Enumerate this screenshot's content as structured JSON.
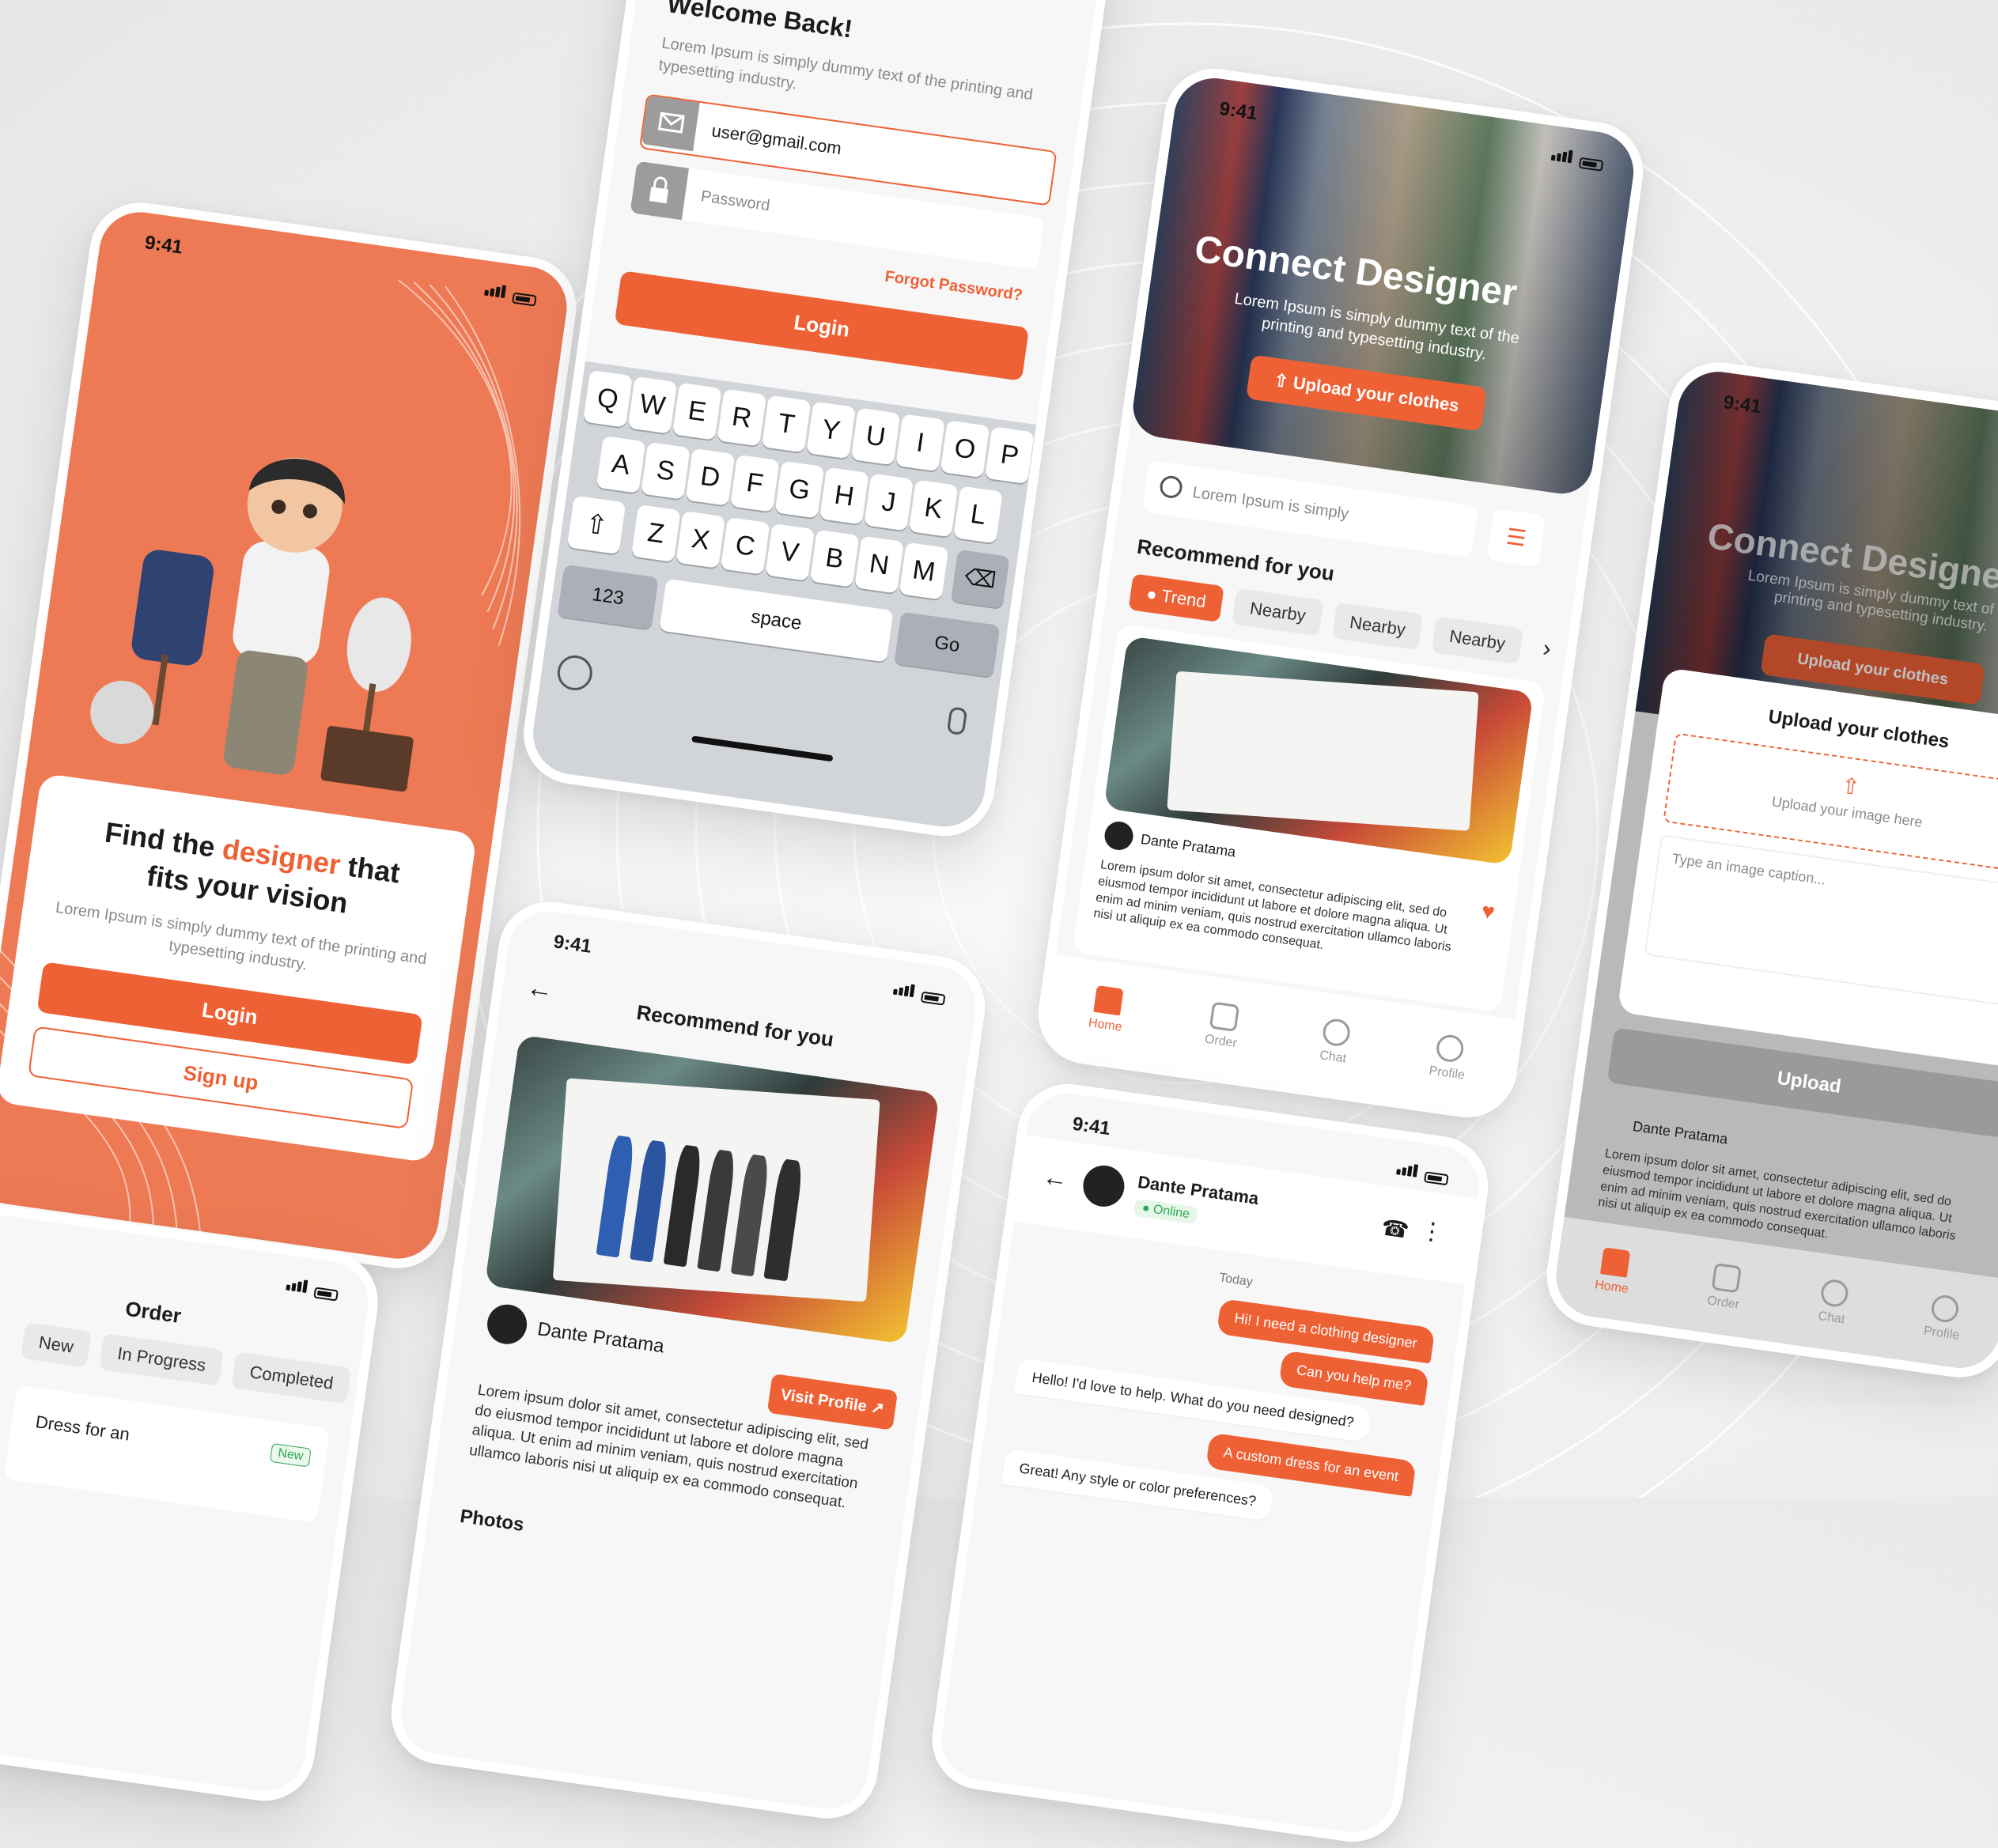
{
  "status_time": "9:41",
  "accent": "#ee6135",
  "onboarding": {
    "title_pre": "Find the",
    "title_accent": "designer",
    "title_post": "that",
    "title_line2": "fits your vision",
    "desc": "Lorem Ipsum is simply dummy text of the printing and typesetting industry.",
    "login": "Login",
    "signup": "Sign up"
  },
  "login_screen": {
    "title": "Welcome Back!",
    "desc": "Lorem Ipsum is simply dummy text of the printing and typesetting industry.",
    "email_value": "user@gmail.com",
    "password_placeholder": "Password",
    "forgot": "Forgot Password?",
    "login": "Login",
    "keyboard": {
      "row1": [
        "Q",
        "W",
        "E",
        "R",
        "T",
        "Y",
        "U",
        "I",
        "O",
        "P"
      ],
      "row2": [
        "A",
        "S",
        "D",
        "F",
        "G",
        "H",
        "J",
        "K",
        "L"
      ],
      "row3": [
        "Z",
        "X",
        "C",
        "V",
        "B",
        "N",
        "M"
      ],
      "num": "123",
      "space": "space",
      "go": "Go"
    }
  },
  "home": {
    "hero_title": "Connect Designer",
    "hero_desc": "Lorem Ipsum is simply dummy text of the printing and typesetting industry.",
    "upload_btn": "Upload your clothes",
    "search_placeholder": "Lorem Ipsum is simply",
    "section_title": "Recommend for you",
    "chips": [
      "Trend",
      "Nearby",
      "Nearby",
      "Nearby"
    ],
    "designer_name": "Dante Pratama",
    "post_text": "Lorem ipsum dolor sit amet, consectetur adipiscing elit, sed do eiusmod tempor incididunt ut labore et dolore magna aliqua. Ut enim ad minim veniam, quis nostrud exercitation ullamco laboris nisi ut aliquip ex ea commodo consequat.",
    "tabs": [
      "Home",
      "Order",
      "Chat",
      "Profile"
    ]
  },
  "upload_modal": {
    "title": "Upload your clothes",
    "dropzone": "Upload your image here",
    "caption_placeholder": "Type an image caption...",
    "button": "Upload"
  },
  "recommend_screen": {
    "title": "Recommend for you",
    "designer_name": "Dante Pratama",
    "visit_profile": "Visit Profile",
    "post_text": "Lorem ipsum dolor sit amet, consectetur adipiscing elit, sed do eiusmod tempor incididunt ut labore et dolore magna aliqua. Ut enim ad minim veniam, quis nostrud exercitation ullamco laboris nisi ut aliquip ex ea commodo consequat.",
    "photos_label": "Photos"
  },
  "chat_screen": {
    "name": "Dante Pratama",
    "status": "Online",
    "day": "Today",
    "messages": [
      {
        "from": "me",
        "text": "Hi! I need a clothing designer"
      },
      {
        "from": "me",
        "text": "Can you help me?"
      },
      {
        "from": "them",
        "text": "Hello! I'd love to help. What do you need designed?"
      },
      {
        "from": "me",
        "text": "A custom dress for an event"
      },
      {
        "from": "them",
        "text": "Great! Any style or color preferences?"
      }
    ]
  },
  "order_screen": {
    "title": "Order",
    "tabs": [
      "New",
      "In Progress",
      "Completed"
    ],
    "item_title": "Dress for an",
    "item_badge": "New"
  }
}
